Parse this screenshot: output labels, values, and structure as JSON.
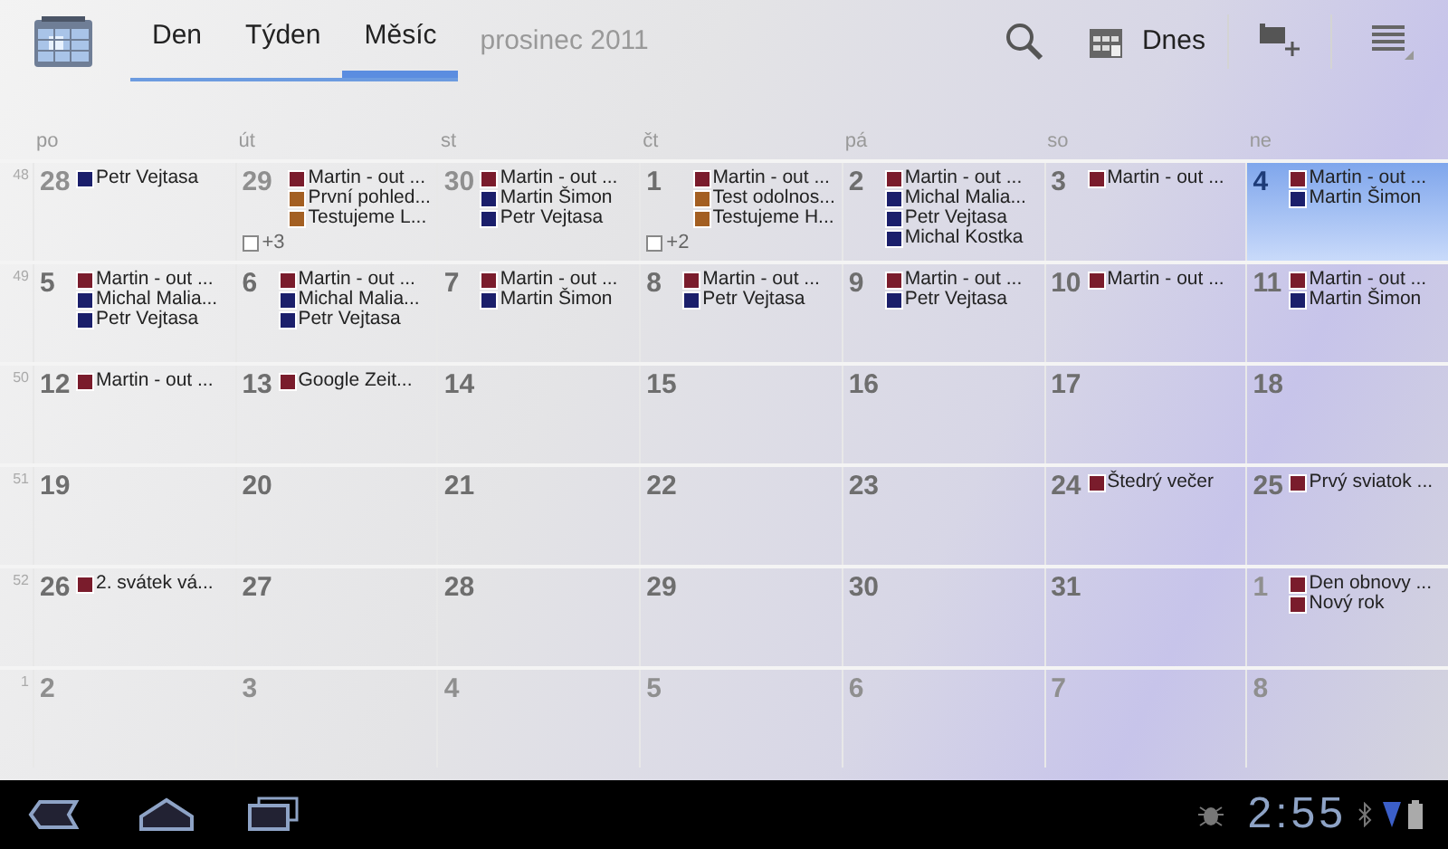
{
  "header": {
    "tabs": [
      {
        "label": "Den",
        "selected": false
      },
      {
        "label": "Týden",
        "selected": false
      },
      {
        "label": "Měsíc",
        "selected": true
      }
    ],
    "title": "prosinec 2011",
    "today_button": "Dnes"
  },
  "weekdays": [
    "po",
    "út",
    "st",
    "čt",
    "pá",
    "so",
    "ne"
  ],
  "weeks": [
    {
      "number": "48",
      "days": [
        {
          "day": "28",
          "other_month": true,
          "selected": false,
          "events": [
            {
              "title": "Petr Vejtasa",
              "color": "#1b1f6b"
            }
          ]
        },
        {
          "day": "29",
          "other_month": true,
          "selected": false,
          "events": [
            {
              "title": "Martin - out ...",
              "color": "#7a1c2c"
            },
            {
              "title": "První pohled...",
              "color": "#a35f22"
            },
            {
              "title": "Testujeme L...",
              "color": "#a35f22"
            }
          ],
          "more": "+3"
        },
        {
          "day": "30",
          "other_month": true,
          "selected": false,
          "events": [
            {
              "title": "Martin - out ...",
              "color": "#7a1c2c"
            },
            {
              "title": "Martin Šimon",
              "color": "#1b1f6b"
            },
            {
              "title": "Petr Vejtasa",
              "color": "#1b1f6b"
            }
          ]
        },
        {
          "day": "1",
          "other_month": false,
          "selected": false,
          "events": [
            {
              "title": "Martin - out ...",
              "color": "#7a1c2c"
            },
            {
              "title": "Test odolnos...",
              "color": "#a35f22"
            },
            {
              "title": "Testujeme H...",
              "color": "#a35f22"
            }
          ],
          "more": "+2"
        },
        {
          "day": "2",
          "other_month": false,
          "selected": false,
          "events": [
            {
              "title": "Martin - out ...",
              "color": "#7a1c2c"
            },
            {
              "title": "Michal Malia...",
              "color": "#1b1f6b"
            },
            {
              "title": "Petr Vejtasa",
              "color": "#1b1f6b"
            },
            {
              "title": "Michal Kostka",
              "color": "#1b1f6b"
            }
          ]
        },
        {
          "day": "3",
          "other_month": false,
          "selected": false,
          "events": [
            {
              "title": "Martin - out ...",
              "color": "#7a1c2c"
            }
          ]
        },
        {
          "day": "4",
          "other_month": false,
          "selected": true,
          "events": [
            {
              "title": "Martin - out ...",
              "color": "#7a1c2c"
            },
            {
              "title": "Martin Šimon",
              "color": "#1b1f6b"
            }
          ]
        }
      ]
    },
    {
      "number": "49",
      "days": [
        {
          "day": "5",
          "other_month": false,
          "selected": false,
          "events": [
            {
              "title": "Martin - out ...",
              "color": "#7a1c2c"
            },
            {
              "title": "Michal Malia...",
              "color": "#1b1f6b"
            },
            {
              "title": "Petr Vejtasa",
              "color": "#1b1f6b"
            }
          ]
        },
        {
          "day": "6",
          "other_month": false,
          "selected": false,
          "events": [
            {
              "title": "Martin - out ...",
              "color": "#7a1c2c"
            },
            {
              "title": "Michal Malia...",
              "color": "#1b1f6b"
            },
            {
              "title": "Petr Vejtasa",
              "color": "#1b1f6b"
            }
          ]
        },
        {
          "day": "7",
          "other_month": false,
          "selected": false,
          "events": [
            {
              "title": "Martin - out ...",
              "color": "#7a1c2c"
            },
            {
              "title": "Martin Šimon",
              "color": "#1b1f6b"
            }
          ]
        },
        {
          "day": "8",
          "other_month": false,
          "selected": false,
          "events": [
            {
              "title": "Martin - out ...",
              "color": "#7a1c2c"
            },
            {
              "title": "Petr Vejtasa",
              "color": "#1b1f6b"
            }
          ]
        },
        {
          "day": "9",
          "other_month": false,
          "selected": false,
          "events": [
            {
              "title": "Martin - out ...",
              "color": "#7a1c2c"
            },
            {
              "title": "Petr Vejtasa",
              "color": "#1b1f6b"
            }
          ]
        },
        {
          "day": "10",
          "other_month": false,
          "selected": false,
          "events": [
            {
              "title": "Martin - out ...",
              "color": "#7a1c2c"
            }
          ]
        },
        {
          "day": "11",
          "other_month": false,
          "selected": false,
          "events": [
            {
              "title": "Martin - out ...",
              "color": "#7a1c2c"
            },
            {
              "title": "Martin Šimon",
              "color": "#1b1f6b"
            }
          ]
        }
      ]
    },
    {
      "number": "50",
      "days": [
        {
          "day": "12",
          "other_month": false,
          "selected": false,
          "events": [
            {
              "title": "Martin - out ...",
              "color": "#7a1c2c"
            }
          ]
        },
        {
          "day": "13",
          "other_month": false,
          "selected": false,
          "events": [
            {
              "title": "Google Zeit...",
              "color": "#7a1c2c"
            }
          ]
        },
        {
          "day": "14",
          "other_month": false,
          "selected": false
        },
        {
          "day": "15",
          "other_month": false,
          "selected": false
        },
        {
          "day": "16",
          "other_month": false,
          "selected": false
        },
        {
          "day": "17",
          "other_month": false,
          "selected": false
        },
        {
          "day": "18",
          "other_month": false,
          "selected": false
        }
      ]
    },
    {
      "number": "51",
      "days": [
        {
          "day": "19",
          "other_month": false,
          "selected": false
        },
        {
          "day": "20",
          "other_month": false,
          "selected": false
        },
        {
          "day": "21",
          "other_month": false,
          "selected": false
        },
        {
          "day": "22",
          "other_month": false,
          "selected": false
        },
        {
          "day": "23",
          "other_month": false,
          "selected": false
        },
        {
          "day": "24",
          "other_month": false,
          "selected": false,
          "events": [
            {
              "title": "Štedrý večer",
              "color": "#7a1c2c"
            }
          ]
        },
        {
          "day": "25",
          "other_month": false,
          "selected": false,
          "events": [
            {
              "title": "Prvý sviatok ...",
              "color": "#7a1c2c"
            }
          ]
        }
      ]
    },
    {
      "number": "52",
      "days": [
        {
          "day": "26",
          "other_month": false,
          "selected": false,
          "events": [
            {
              "title": "2. svátek vá...",
              "color": "#7a1c2c"
            }
          ]
        },
        {
          "day": "27",
          "other_month": false,
          "selected": false
        },
        {
          "day": "28",
          "other_month": false,
          "selected": false
        },
        {
          "day": "29",
          "other_month": false,
          "selected": false
        },
        {
          "day": "30",
          "other_month": false,
          "selected": false
        },
        {
          "day": "31",
          "other_month": false,
          "selected": false
        },
        {
          "day": "1",
          "other_month": true,
          "selected": false,
          "events": [
            {
              "title": "Den obnovy ...",
              "color": "#7a1c2c"
            },
            {
              "title": "Nový rok",
              "color": "#7a1c2c"
            }
          ]
        }
      ]
    },
    {
      "number": "1",
      "days": [
        {
          "day": "2",
          "other_month": true,
          "selected": false
        },
        {
          "day": "3",
          "other_month": true,
          "selected": false
        },
        {
          "day": "4",
          "other_month": true,
          "selected": false
        },
        {
          "day": "5",
          "other_month": true,
          "selected": false
        },
        {
          "day": "6",
          "other_month": true,
          "selected": false
        },
        {
          "day": "7",
          "other_month": true,
          "selected": false
        },
        {
          "day": "8",
          "other_month": true,
          "selected": false
        }
      ]
    }
  ],
  "status_bar": {
    "time": "2:55"
  }
}
